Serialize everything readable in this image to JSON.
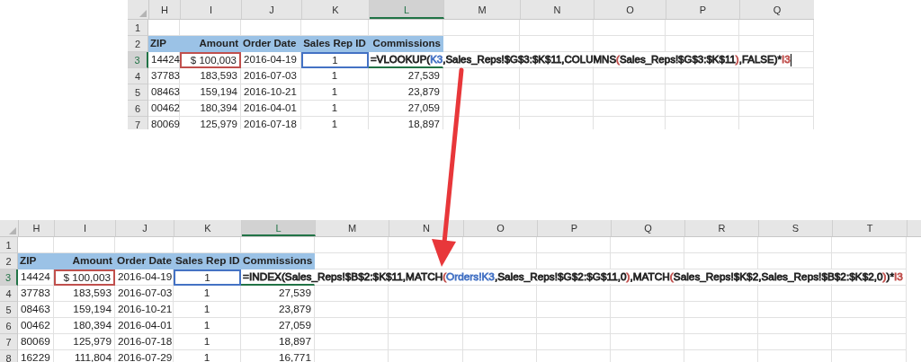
{
  "sheets": [
    {
      "columns": [
        {
          "label": "H",
          "selected": false
        },
        {
          "label": "I",
          "selected": false
        },
        {
          "label": "J",
          "selected": false
        },
        {
          "label": "K",
          "selected": false
        },
        {
          "label": "L",
          "selected": true
        },
        {
          "label": "M",
          "selected": false
        },
        {
          "label": "N",
          "selected": false
        },
        {
          "label": "O",
          "selected": false
        },
        {
          "label": "P",
          "selected": false
        },
        {
          "label": "Q",
          "selected": false
        }
      ],
      "editing_cursor": true,
      "rows": [
        {
          "number": "1",
          "kind": "blank",
          "selected": false
        },
        {
          "number": "2",
          "kind": "header",
          "selected": false,
          "cells": [
            {
              "text": "ZIP"
            },
            {
              "text": "Amount"
            },
            {
              "text": "Order Date"
            },
            {
              "text": "Sales Rep ID"
            },
            {
              "text": "Commissions"
            }
          ]
        },
        {
          "number": "3",
          "kind": "data",
          "selected": true,
          "cells": [
            {
              "text": "14424"
            },
            {
              "text": "$ 100,003",
              "color": "#c0504d"
            },
            {
              "text": "2016-04-19"
            },
            {
              "text": "1",
              "color": "#4472c4"
            },
            {
              "kind": "formula",
              "active": true,
              "parts": [
                {
                  "text": "=VLOOKUP(",
                  "color": "#222222"
                },
                {
                  "text": "K3",
                  "color": "#4472c4"
                },
                {
                  "text": ",Sales_Reps!$G$3:$K$11,COLUMNS",
                  "color": "#222222"
                },
                {
                  "text": "(",
                  "color": "#c0504d"
                },
                {
                  "text": "Sales_Reps!$G$3:$K$11",
                  "color": "#222222"
                },
                {
                  "text": ")",
                  "color": "#c0504d"
                },
                {
                  "text": ",FALSE)*",
                  "color": "#222222"
                },
                {
                  "text": "I3",
                  "color": "#c0504d"
                }
              ]
            }
          ]
        },
        {
          "number": "4",
          "kind": "data",
          "selected": false,
          "cells": [
            {
              "text": "37783"
            },
            {
              "text": "183,593"
            },
            {
              "text": "2016-07-03"
            },
            {
              "text": "1"
            },
            {
              "text": "27,539"
            }
          ]
        },
        {
          "number": "5",
          "kind": "data",
          "selected": false,
          "cells": [
            {
              "text": "08463"
            },
            {
              "text": "159,194"
            },
            {
              "text": "2016-10-21"
            },
            {
              "text": "1"
            },
            {
              "text": "23,879"
            }
          ]
        },
        {
          "number": "6",
          "kind": "data",
          "selected": false,
          "cells": [
            {
              "text": "00462"
            },
            {
              "text": "180,394"
            },
            {
              "text": "2016-04-01"
            },
            {
              "text": "1"
            },
            {
              "text": "27,059"
            }
          ]
        },
        {
          "number": "7",
          "kind": "data",
          "selected": false,
          "cells": [
            {
              "text": "80069"
            },
            {
              "text": "125,979"
            },
            {
              "text": "2016-07-18"
            },
            {
              "text": "1"
            },
            {
              "text": "18,897"
            }
          ]
        }
      ]
    },
    {
      "columns": [
        {
          "label": "H",
          "selected": false
        },
        {
          "label": "I",
          "selected": false
        },
        {
          "label": "J",
          "selected": false
        },
        {
          "label": "K",
          "selected": false
        },
        {
          "label": "L",
          "selected": true
        },
        {
          "label": "M",
          "selected": false
        },
        {
          "label": "N",
          "selected": false
        },
        {
          "label": "O",
          "selected": false
        },
        {
          "label": "P",
          "selected": false
        },
        {
          "label": "Q",
          "selected": false
        },
        {
          "label": "R",
          "selected": false
        },
        {
          "label": "S",
          "selected": false
        },
        {
          "label": "T",
          "selected": false
        }
      ],
      "editing_cursor": false,
      "rows": [
        {
          "number": "1",
          "kind": "blank",
          "selected": false
        },
        {
          "number": "2",
          "kind": "header",
          "selected": false,
          "cells": [
            {
              "text": "ZIP"
            },
            {
              "text": "Amount"
            },
            {
              "text": "Order Date"
            },
            {
              "text": "Sales Rep ID"
            },
            {
              "text": "Commissions"
            }
          ]
        },
        {
          "number": "3",
          "kind": "data",
          "selected": true,
          "cells": [
            {
              "text": "14424"
            },
            {
              "text": "$ 100,003",
              "color": "#c0504d"
            },
            {
              "text": "2016-04-19"
            },
            {
              "text": "1",
              "color": "#4472c4"
            },
            {
              "kind": "formula",
              "active": true,
              "parts": [
                {
                  "text": "=INDEX(Sales_Reps!$B$2:$K$11,MATCH",
                  "color": "#222222"
                },
                {
                  "text": "(",
                  "color": "#c0504d"
                },
                {
                  "text": "Orders!K3",
                  "color": "#4472c4"
                },
                {
                  "text": ",Sales_Reps!$G$2:$G$11,0",
                  "color": "#222222"
                },
                {
                  "text": ")",
                  "color": "#c0504d"
                },
                {
                  "text": ",MATCH",
                  "color": "#222222"
                },
                {
                  "text": "(",
                  "color": "#c0504d"
                },
                {
                  "text": "Sales_Reps!$K$2,Sales_Reps!$B$2:$K$2,0",
                  "color": "#222222"
                },
                {
                  "text": ")",
                  "color": "#c0504d"
                },
                {
                  "text": ")*",
                  "color": "#222222"
                },
                {
                  "text": "I3",
                  "color": "#c0504d"
                }
              ]
            }
          ]
        },
        {
          "number": "4",
          "kind": "data",
          "selected": false,
          "cells": [
            {
              "text": "37783"
            },
            {
              "text": "183,593"
            },
            {
              "text": "2016-07-03"
            },
            {
              "text": "1"
            },
            {
              "text": "27,539"
            }
          ]
        },
        {
          "number": "5",
          "kind": "data",
          "selected": false,
          "cells": [
            {
              "text": "08463"
            },
            {
              "text": "159,194"
            },
            {
              "text": "2016-10-21"
            },
            {
              "text": "1"
            },
            {
              "text": "23,879"
            }
          ]
        },
        {
          "number": "6",
          "kind": "data",
          "selected": false,
          "cells": [
            {
              "text": "00462"
            },
            {
              "text": "180,394"
            },
            {
              "text": "2016-04-01"
            },
            {
              "text": "1"
            },
            {
              "text": "27,059"
            }
          ]
        },
        {
          "number": "7",
          "kind": "data",
          "selected": false,
          "cells": [
            {
              "text": "80069"
            },
            {
              "text": "125,979"
            },
            {
              "text": "2016-07-18"
            },
            {
              "text": "1"
            },
            {
              "text": "18,897"
            }
          ]
        },
        {
          "number": "8",
          "kind": "data",
          "selected": false,
          "cells": [
            {
              "text": "16229"
            },
            {
              "text": "111,804"
            },
            {
              "text": "2016-07-29"
            },
            {
              "text": "1"
            },
            {
              "text": "16,771"
            }
          ]
        }
      ]
    }
  ]
}
